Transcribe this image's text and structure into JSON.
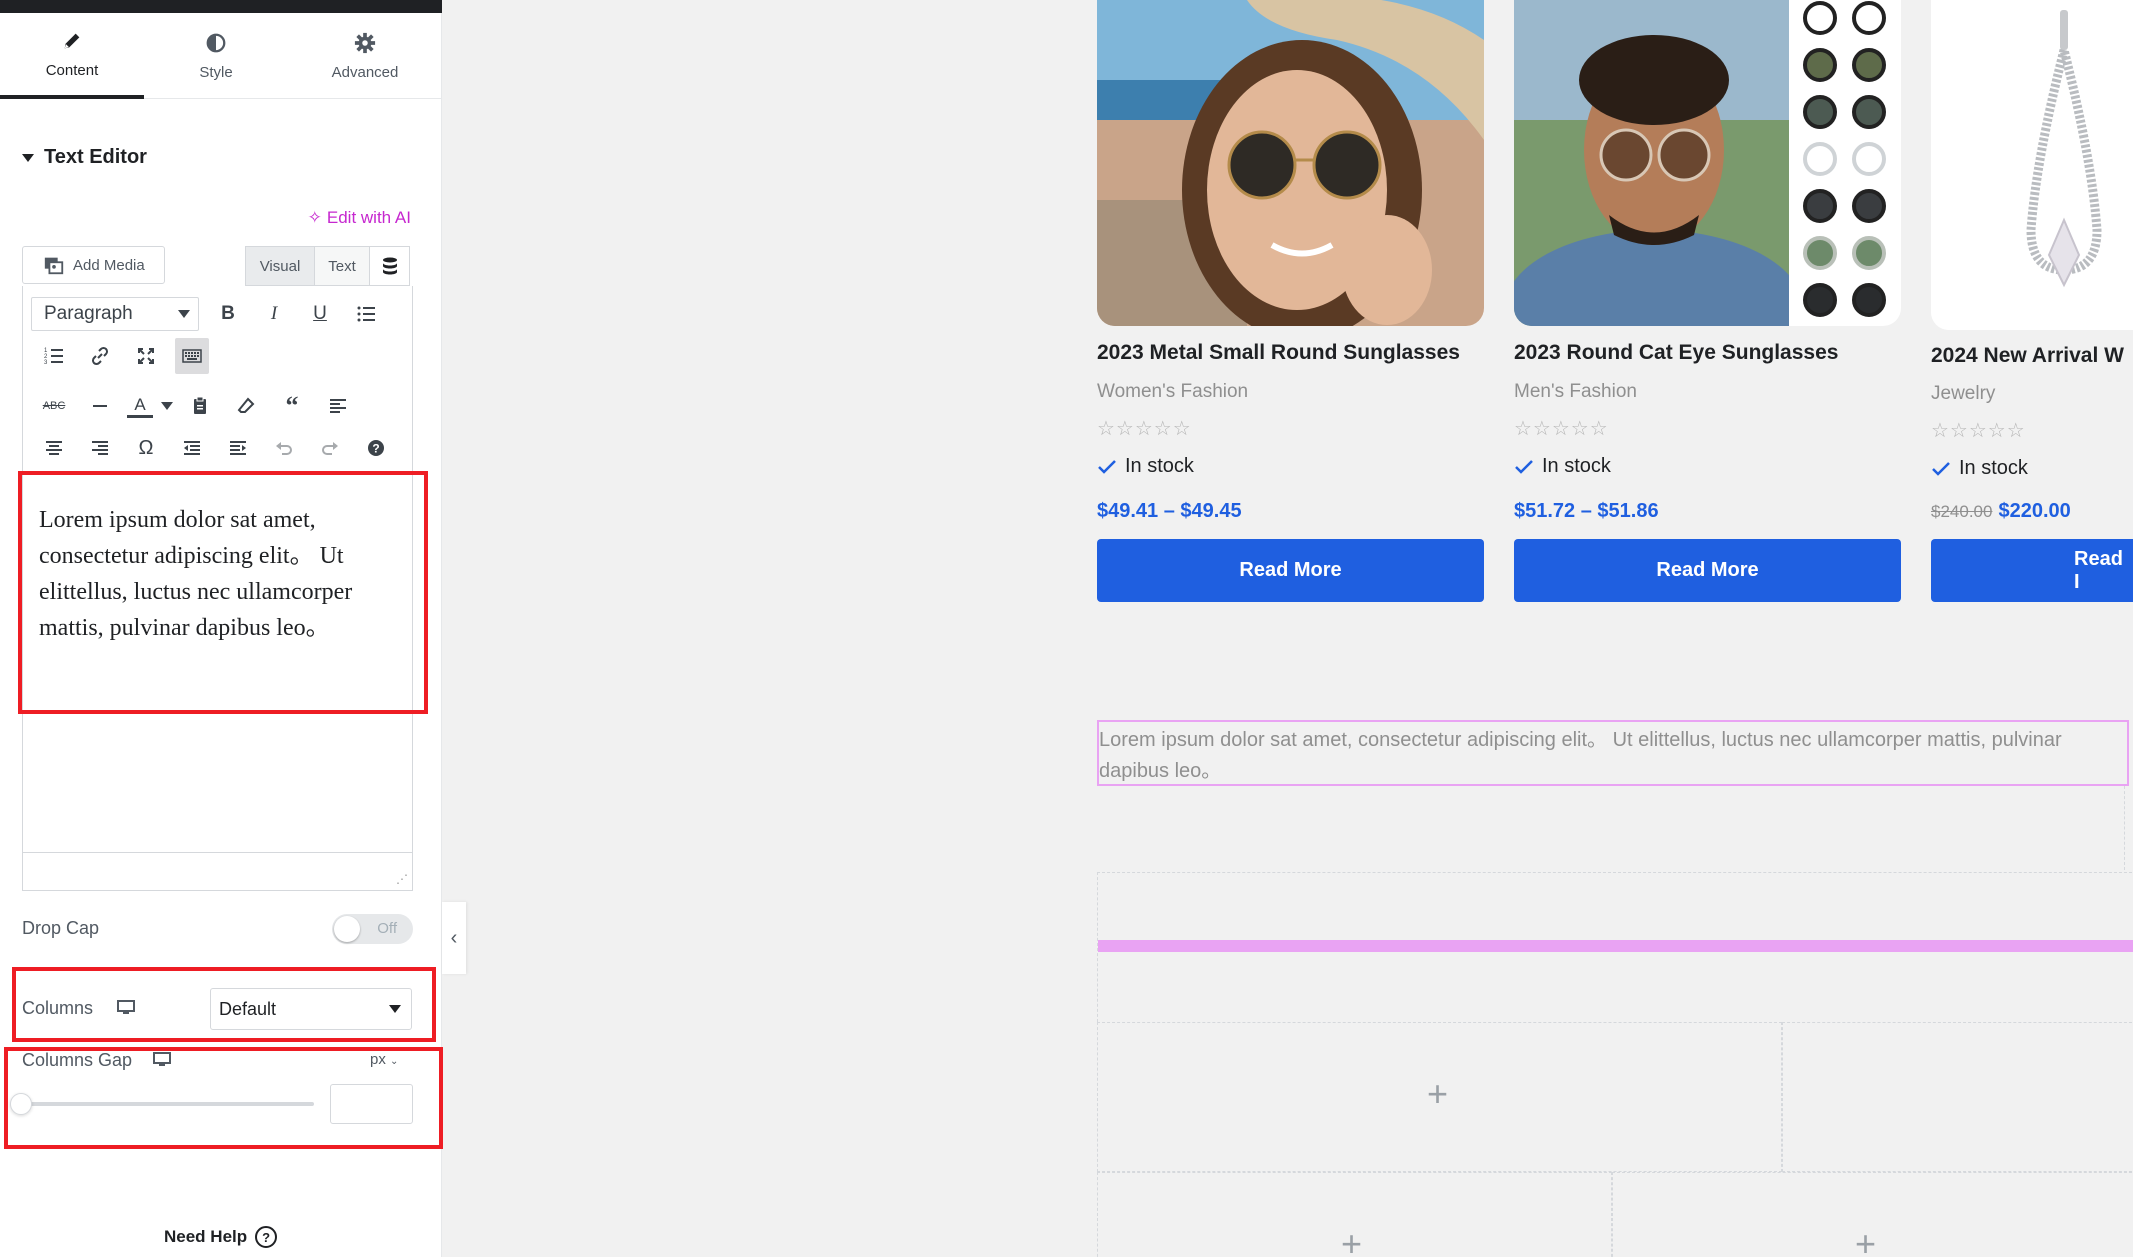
{
  "panel": {
    "tabs": [
      {
        "label": "Content",
        "icon": "pencil-icon"
      },
      {
        "label": "Style",
        "icon": "half-circle-icon"
      },
      {
        "label": "Advanced",
        "icon": "gear-icon"
      }
    ],
    "section_title": "Text Editor",
    "edit_ai": "Edit with AI",
    "add_media": "Add Media",
    "visual_tab": "Visual",
    "text_tab": "Text",
    "format_select": "Paragraph",
    "editor_content": "Lorem ipsum dolor sat amet, consectetur adipiscing elit。 Ut elittellus, luctus nec ullamcorper mattis, pulvinar dapibus leo。",
    "drop_cap_label": "Drop Cap",
    "drop_cap_toggle": "Off",
    "columns_label": "Columns",
    "columns_value": "Default",
    "columns_gap_label": "Columns Gap",
    "columns_gap_unit": "px",
    "need_help": "Need Help"
  },
  "products": [
    {
      "title": "2023 Metal Small Round Sunglasses",
      "category": "Women's Fashion",
      "stock": "In stock",
      "price": "$49.41 – $49.45",
      "old_price": "",
      "button": "Read More"
    },
    {
      "title": "2023 Round Cat Eye Sunglasses",
      "category": "Men's Fashion",
      "stock": "In stock",
      "price": "$51.72 – $51.86",
      "old_price": "",
      "button": "Read More"
    },
    {
      "title": "2024 New Arrival W",
      "category": "Jewelry",
      "stock": "In stock",
      "price": "$220.00",
      "old_price": "$240.00",
      "button": "Read I"
    }
  ],
  "preview_text": "Lorem ipsum dolor sat amet, consectetur adipiscing elit。 Ut elittellus, luctus nec ullamcorper mattis, pulvinar dapibus leo。",
  "colors": {
    "accent_blue": "#1f5fe0",
    "highlight_red": "#ee1d24",
    "ai_purple": "#c627cf",
    "selection_pink": "#e9a3f3"
  }
}
